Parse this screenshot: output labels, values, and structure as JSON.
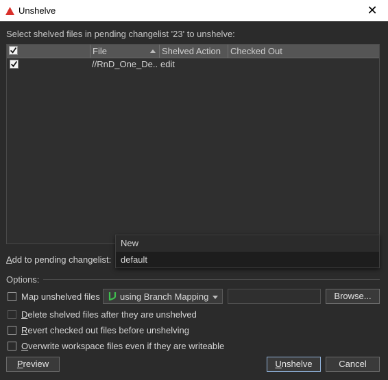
{
  "window": {
    "title": "Unshelve",
    "close_glyph": "✕"
  },
  "prompt": "Select shelved files in pending changelist '23' to unshelve:",
  "table": {
    "columns": [
      "File",
      "Shelved Action",
      "Checked Out"
    ],
    "header_checked": true,
    "rows": [
      {
        "checked": true,
        "file": "//RnD_One_De...",
        "action": "edit",
        "checked_out": ""
      }
    ]
  },
  "add_to_changelist": {
    "label_prefix": "A",
    "label_rest": "dd to pending changelist:",
    "dropdown_options": [
      "New",
      "default"
    ],
    "highlighted": "default"
  },
  "options": {
    "label": "Options:",
    "map_unshelved_label": "Map unshelved files",
    "mapping_value": "using Branch Mapping",
    "mapping_icon": "branch-mapping-icon",
    "browse_label": "Browse...",
    "delete_after": {
      "underline": "D",
      "rest": "elete shelved files after they are unshelved"
    },
    "revert_before": {
      "underline": "R",
      "rest": "evert checked out files before unshelving"
    },
    "overwrite": {
      "underline": "O",
      "rest": "verwrite workspace files even if they are writeable"
    }
  },
  "buttons": {
    "preview": {
      "underline": "P",
      "rest": "review"
    },
    "unshelve": {
      "underline": "U",
      "rest": "nshelve"
    },
    "cancel": "Cancel"
  },
  "colors": {
    "accent_red": "#d9302b",
    "primary_border": "#8fb0d8",
    "branch_icon": "#3fbf4f"
  }
}
